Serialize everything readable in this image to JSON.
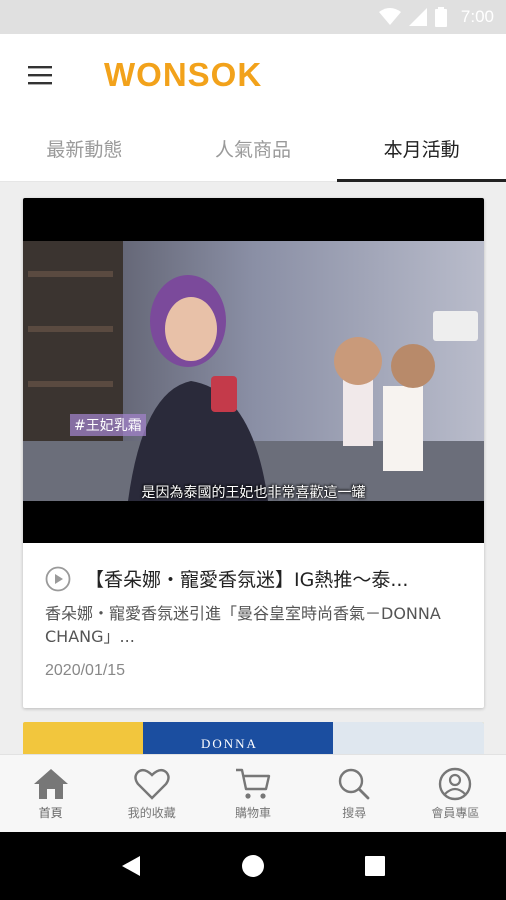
{
  "status_bar": {
    "time": "7:00"
  },
  "app": {
    "logo": "WONSOK"
  },
  "tabs": [
    {
      "label": "最新動態",
      "active": false
    },
    {
      "label": "人氣商品",
      "active": false
    },
    {
      "label": "本月活動",
      "active": true
    }
  ],
  "card": {
    "hashtag": "#王妃乳霜",
    "video_subtitle": "是因為泰國的王妃也非常喜歡這一罐",
    "title": "【香朵娜・寵愛香氛迷】IG熱推～泰...",
    "description": "香朵娜・寵愛香氛迷引進「曼谷皇室時尚香氣－DONNA CHANG」...",
    "date": "2020/01/15"
  },
  "card2": {
    "brand": "DONNA"
  },
  "bottom_nav": [
    {
      "label": "首頁",
      "icon": "home-icon"
    },
    {
      "label": "我的收藏",
      "icon": "heart-icon"
    },
    {
      "label": "購物車",
      "icon": "cart-icon"
    },
    {
      "label": "搜尋",
      "icon": "search-icon"
    },
    {
      "label": "會員專區",
      "icon": "account-icon"
    }
  ],
  "colors": {
    "accent": "#f2a21b",
    "nav_icon": "#777777"
  }
}
